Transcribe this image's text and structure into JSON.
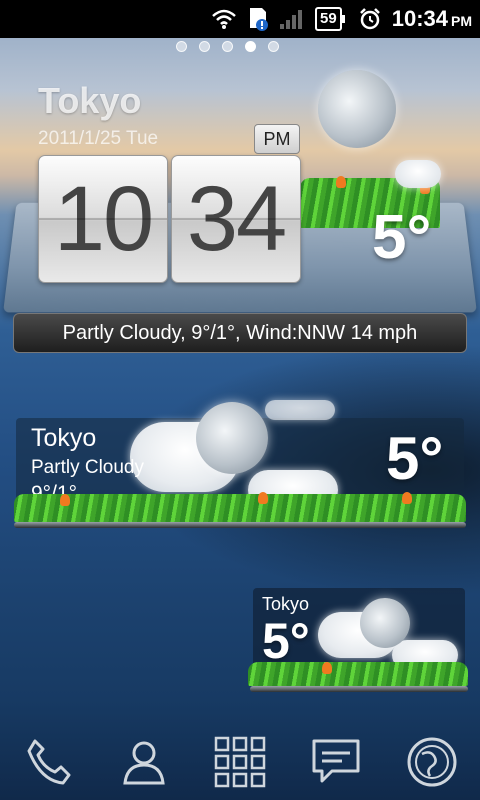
{
  "status_bar": {
    "battery": "59",
    "time": "10:34",
    "ampm": "PM",
    "icons": [
      "wifi-icon",
      "sim-alert-icon",
      "signal-icon",
      "battery-icon",
      "alarm-icon"
    ]
  },
  "home_pages": {
    "count": 5,
    "active_index": 3
  },
  "clock_widget": {
    "city": "Tokyo",
    "date": "2011/1/25 Tue",
    "ampm": "PM",
    "hour": "10",
    "minute": "34",
    "temperature": "5°",
    "condition_line": "Partly Cloudy, 9°/1°, Wind:NNW 14 mph",
    "icon": "moon-icon"
  },
  "weather_widget_medium": {
    "city": "Tokyo",
    "condition": "Partly Cloudy",
    "range": "9°/1°",
    "temperature": "5°",
    "icon": "partly-cloudy-night-icon"
  },
  "weather_widget_small": {
    "city": "Tokyo",
    "temperature": "5°",
    "icon": "partly-cloudy-night-icon"
  },
  "dock": {
    "items": [
      "phone-icon",
      "contacts-icon",
      "app-drawer-icon",
      "messaging-icon",
      "browser-icon"
    ]
  },
  "colors": {
    "status_bar": "#000000",
    "grass": "#3fa52a",
    "flower": "#f07a20",
    "condition_bar": "#1e1e1e"
  }
}
